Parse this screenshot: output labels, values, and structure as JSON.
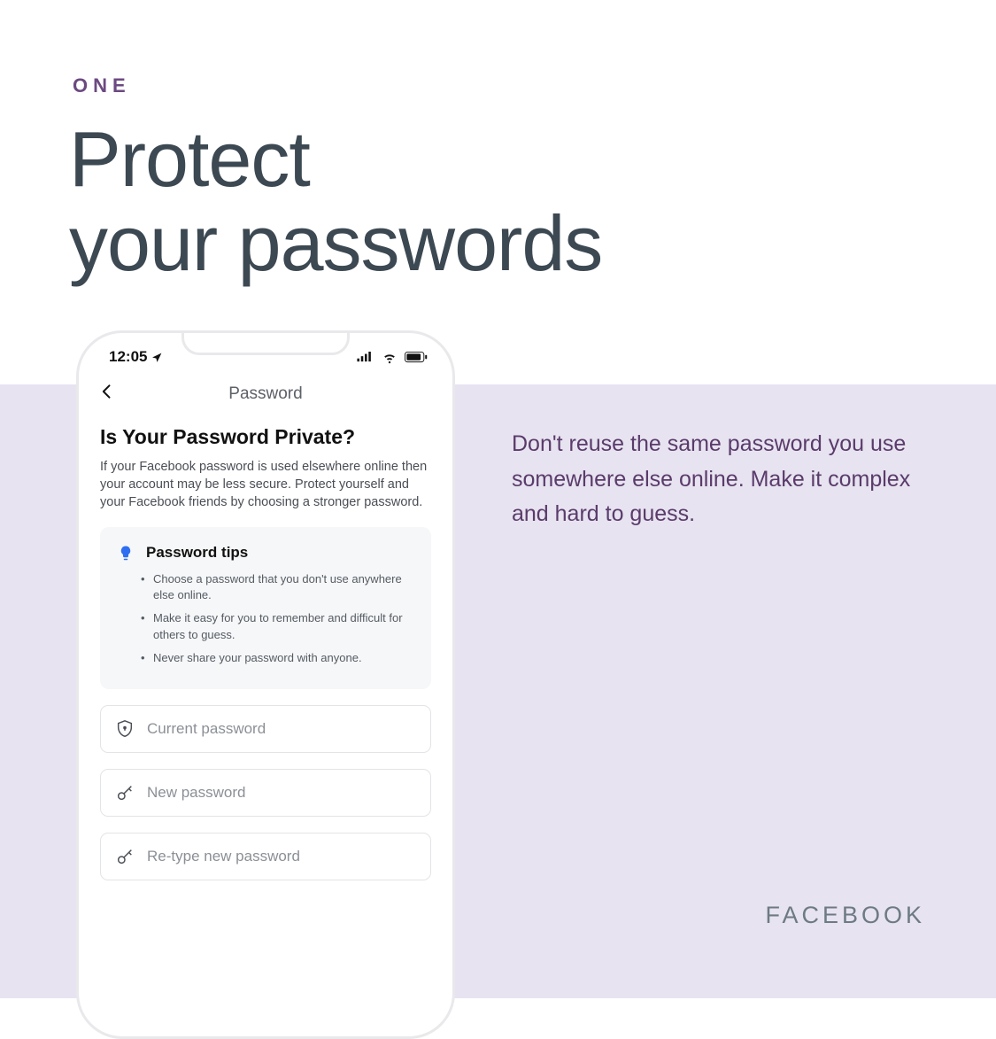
{
  "eyebrow": "ONE",
  "headline_line1": "Protect",
  "headline_line2": "your passwords",
  "side_copy": "Don't reuse the same password you use somewhere else online. Make it complex and hard to guess.",
  "brand": "FACEBOOK",
  "phone": {
    "status": {
      "time": "12:05",
      "location_icon": "location-arrow",
      "signal_icon": "cellular-signal",
      "wifi_icon": "wifi",
      "battery_icon": "battery"
    },
    "nav": {
      "back_icon": "chevron-left",
      "title": "Password"
    },
    "heading": "Is Your Password Private?",
    "description": "If your Facebook password is used elsewhere online then your account may be less secure. Protect yourself and your Facebook friends by choosing a stronger password.",
    "tips": {
      "icon": "lightbulb",
      "title": "Password tips",
      "items": [
        "Choose a password that you don't use anywhere else online.",
        "Make it easy for you to remember and difficult for others to guess.",
        "Never share your password with anyone."
      ]
    },
    "fields": {
      "current": {
        "icon": "shield-lock",
        "placeholder": "Current password"
      },
      "new": {
        "icon": "key",
        "placeholder": "New password"
      },
      "retype": {
        "icon": "key",
        "placeholder": "Re-type new password"
      }
    }
  }
}
